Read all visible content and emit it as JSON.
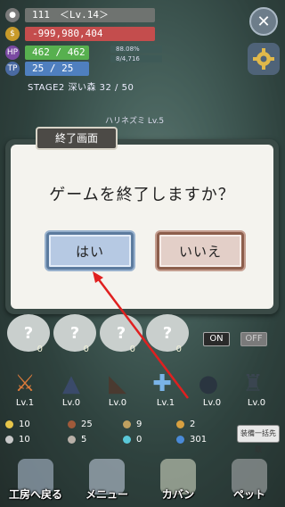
{
  "status": {
    "name": "111　＜Lv.14＞",
    "money": "-999,980,404",
    "hp": "462 / 462",
    "mp": "25 / 25",
    "mini1": "88.08%",
    "mini2": "8/4,716",
    "stage": "STAGE2 深い森 32 / 50",
    "enemy_label": "ハリネズミ Lv.5"
  },
  "modal": {
    "tag": "終了画面",
    "message": "ゲームを終了しますか？",
    "yes": "はい",
    "no": "いいえ"
  },
  "quick_slots": [
    {
      "mark": "?",
      "count": "0"
    },
    {
      "mark": "?",
      "count": "0"
    },
    {
      "mark": "?",
      "count": "0"
    },
    {
      "mark": "?",
      "count": "0"
    }
  ],
  "toggles": {
    "on": "ON",
    "off": "OFF"
  },
  "equipment_levels": [
    "Lv.1",
    "Lv.0",
    "Lv.0",
    "Lv.1",
    "Lv.0",
    "Lv.0"
  ],
  "resources": {
    "r1": "10",
    "r2": "25",
    "r3": "9",
    "r4": "2",
    "r5": "10",
    "r6": "5",
    "r7": "0",
    "r8": "301"
  },
  "equip_all": "装備一括先取",
  "nav": [
    "工房へ戻る",
    "メニュー",
    "カバン",
    "ペット"
  ],
  "colors": {
    "accent_arrow": "#e02020",
    "yes_button": "#b6c9e3",
    "no_button": "#e3cfc8"
  }
}
